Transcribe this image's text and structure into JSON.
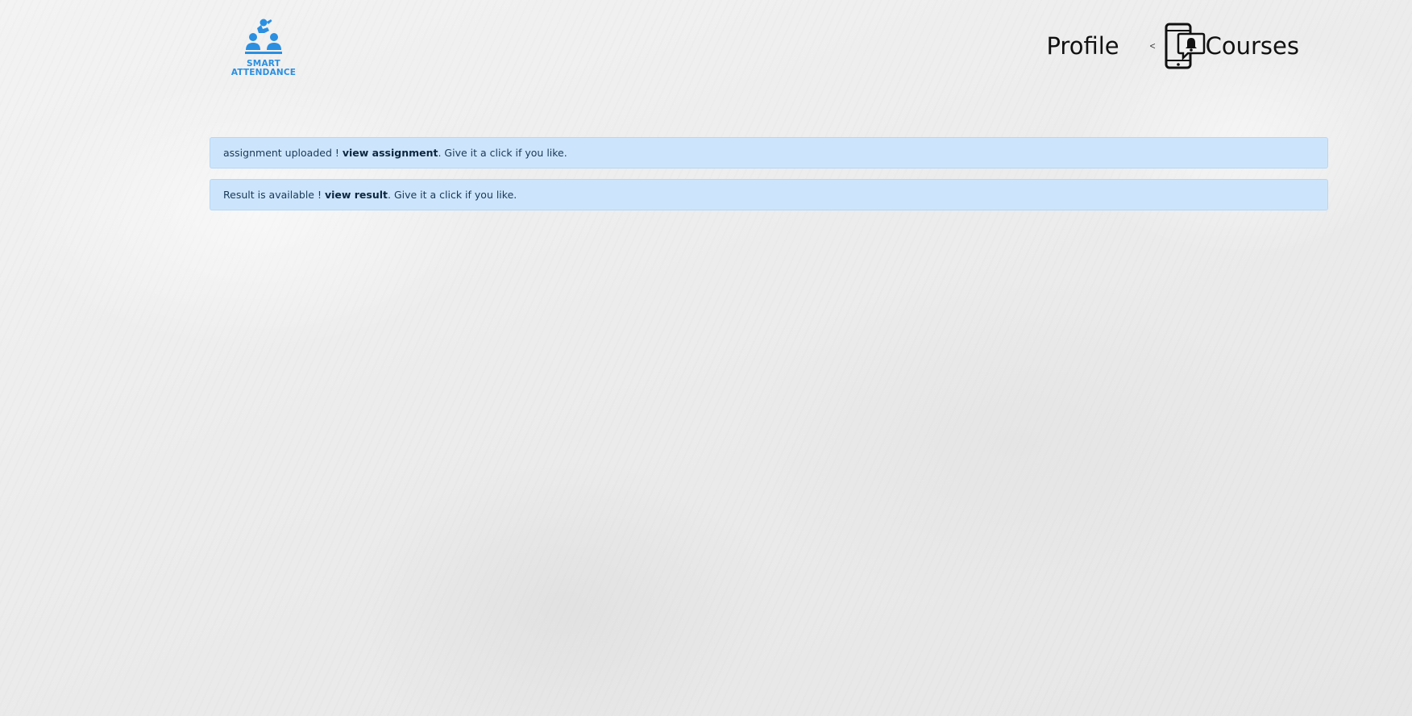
{
  "logo": {
    "line1": "SMART",
    "line2": "ATTENDANCE",
    "icon": "classroom-people-icon",
    "color": "#2a8fe0"
  },
  "nav": {
    "profile_label": "Profile",
    "separator": "<",
    "notification_icon": "phone-notification-bell-icon",
    "courses_label": "Courses"
  },
  "alerts": [
    {
      "prefix": "assignment uploaded ! ",
      "link_label": "view assignment",
      "suffix": ". Give it a click if you like."
    },
    {
      "prefix": "Result is available ! ",
      "link_label": "view result",
      "suffix": ". Give it a click if you like."
    }
  ],
  "colors": {
    "alert_bg": "#cce5fc",
    "alert_border": "#b6d7f7",
    "alert_text": "#183859"
  }
}
